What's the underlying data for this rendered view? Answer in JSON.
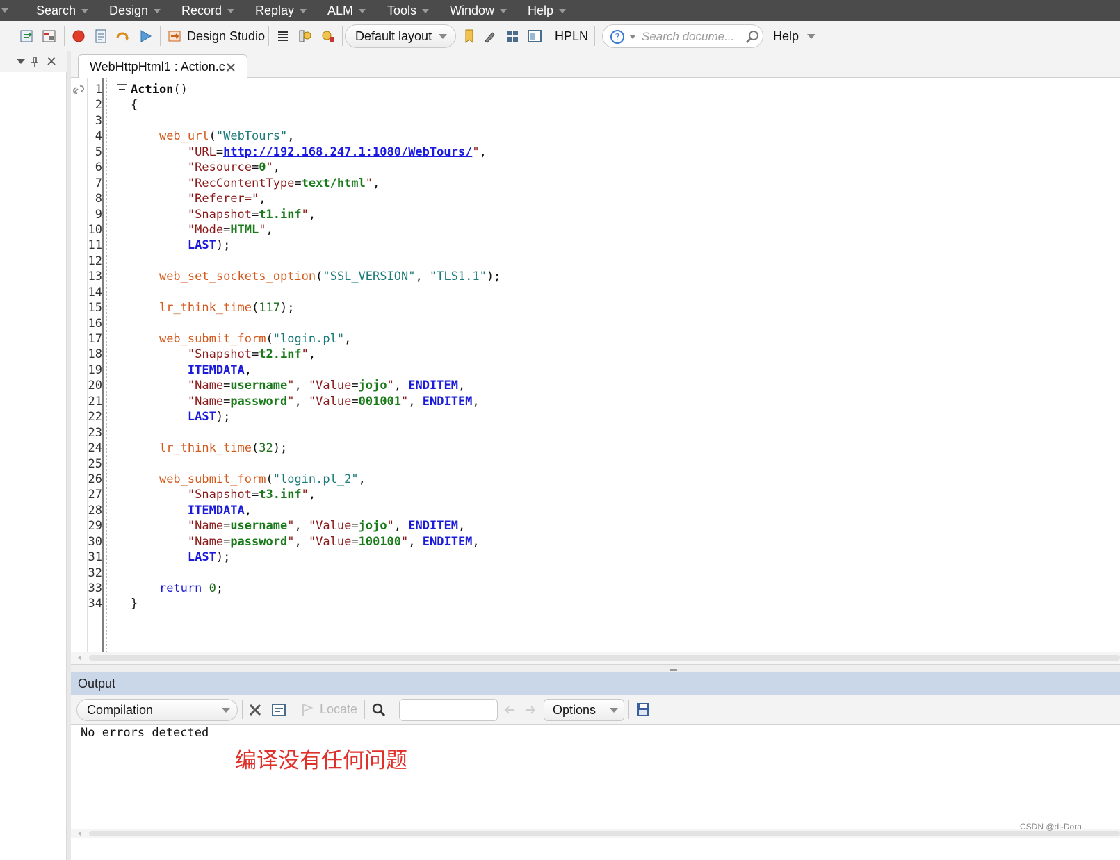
{
  "menu": {
    "items": [
      {
        "label": "Search"
      },
      {
        "label": "Design"
      },
      {
        "label": "Record"
      },
      {
        "label": "Replay"
      },
      {
        "label": "ALM"
      },
      {
        "label": "Tools"
      },
      {
        "label": "Window"
      },
      {
        "label": "Help"
      }
    ]
  },
  "toolbar": {
    "design_studio_label": "Design Studio",
    "layout_label": "Default layout",
    "hpln_label": "HPLN",
    "search_placeholder": "Search docume...",
    "help_label": "Help"
  },
  "editor": {
    "tab_title": "WebHttpHtml1 : Action.c",
    "line_numbers": [
      "1",
      "2",
      "3",
      "4",
      "5",
      "6",
      "7",
      "8",
      "9",
      "10",
      "11",
      "12",
      "13",
      "14",
      "15",
      "16",
      "17",
      "18",
      "19",
      "20",
      "21",
      "22",
      "23",
      "24",
      "25",
      "26",
      "27",
      "28",
      "29",
      "30",
      "31",
      "32",
      "33",
      "34"
    ],
    "code_lines": [
      [
        {
          "t": "Action",
          "c": "bold"
        },
        {
          "t": "()",
          "c": ""
        }
      ],
      [
        {
          "t": "{",
          "c": ""
        }
      ],
      [],
      [
        {
          "t": "    ",
          "c": ""
        },
        {
          "t": "web_url",
          "c": "fn"
        },
        {
          "t": "(",
          "c": ""
        },
        {
          "t": "\"WebTours\"",
          "c": "str"
        },
        {
          "t": ",",
          "c": ""
        }
      ],
      [
        {
          "t": "        \"",
          "c": "sv"
        },
        {
          "t": "URL",
          "c": "sv"
        },
        {
          "t": "=",
          "c": ""
        },
        {
          "t": "http://192.168.247.1:1080/WebTours/",
          "c": "url"
        },
        {
          "t": "\"",
          "c": "sv"
        },
        {
          "t": ",",
          "c": ""
        }
      ],
      [
        {
          "t": "        \"Resource",
          "c": "sv"
        },
        {
          "t": "=",
          "c": ""
        },
        {
          "t": "0",
          "c": "val"
        },
        {
          "t": "\"",
          "c": "sv"
        },
        {
          "t": ",",
          "c": ""
        }
      ],
      [
        {
          "t": "        \"RecContentType",
          "c": "sv"
        },
        {
          "t": "=",
          "c": ""
        },
        {
          "t": "text/html",
          "c": "val"
        },
        {
          "t": "\"",
          "c": "sv"
        },
        {
          "t": ",",
          "c": ""
        }
      ],
      [
        {
          "t": "        \"Referer=\"",
          "c": "sv"
        },
        {
          "t": ",",
          "c": ""
        }
      ],
      [
        {
          "t": "        \"Snapshot",
          "c": "sv"
        },
        {
          "t": "=",
          "c": ""
        },
        {
          "t": "t1.inf",
          "c": "val"
        },
        {
          "t": "\"",
          "c": "sv"
        },
        {
          "t": ",",
          "c": ""
        }
      ],
      [
        {
          "t": "        \"Mode",
          "c": "sv"
        },
        {
          "t": "=",
          "c": ""
        },
        {
          "t": "HTML",
          "c": "val"
        },
        {
          "t": "\"",
          "c": "sv"
        },
        {
          "t": ",",
          "c": ""
        }
      ],
      [
        {
          "t": "        ",
          "c": ""
        },
        {
          "t": "LAST",
          "c": "kwb"
        },
        {
          "t": ");",
          "c": ""
        }
      ],
      [],
      [
        {
          "t": "    ",
          "c": ""
        },
        {
          "t": "web_set_sockets_option",
          "c": "fn"
        },
        {
          "t": "(",
          "c": ""
        },
        {
          "t": "\"SSL_VERSION\"",
          "c": "str"
        },
        {
          "t": ", ",
          "c": ""
        },
        {
          "t": "\"TLS1.1\"",
          "c": "str"
        },
        {
          "t": ");",
          "c": ""
        }
      ],
      [],
      [
        {
          "t": "    ",
          "c": ""
        },
        {
          "t": "lr_think_time",
          "c": "fn"
        },
        {
          "t": "(",
          "c": ""
        },
        {
          "t": "117",
          "c": "num"
        },
        {
          "t": ");",
          "c": ""
        }
      ],
      [],
      [
        {
          "t": "    ",
          "c": ""
        },
        {
          "t": "web_submit_form",
          "c": "fn"
        },
        {
          "t": "(",
          "c": ""
        },
        {
          "t": "\"login.pl\"",
          "c": "str"
        },
        {
          "t": ",",
          "c": ""
        }
      ],
      [
        {
          "t": "        \"Snapshot",
          "c": "sv"
        },
        {
          "t": "=",
          "c": ""
        },
        {
          "t": "t2.inf",
          "c": "val"
        },
        {
          "t": "\"",
          "c": "sv"
        },
        {
          "t": ",",
          "c": ""
        }
      ],
      [
        {
          "t": "        ",
          "c": ""
        },
        {
          "t": "ITEMDATA",
          "c": "kwb"
        },
        {
          "t": ",",
          "c": ""
        }
      ],
      [
        {
          "t": "        \"Name",
          "c": "sv"
        },
        {
          "t": "=",
          "c": ""
        },
        {
          "t": "username",
          "c": "val"
        },
        {
          "t": "\"",
          "c": "sv"
        },
        {
          "t": ", ",
          "c": ""
        },
        {
          "t": "\"Value",
          "c": "sv"
        },
        {
          "t": "=",
          "c": ""
        },
        {
          "t": "jojo",
          "c": "val"
        },
        {
          "t": "\"",
          "c": "sv"
        },
        {
          "t": ", ",
          "c": ""
        },
        {
          "t": "ENDITEM",
          "c": "kwb"
        },
        {
          "t": ",",
          "c": ""
        }
      ],
      [
        {
          "t": "        \"Name",
          "c": "sv"
        },
        {
          "t": "=",
          "c": ""
        },
        {
          "t": "password",
          "c": "val"
        },
        {
          "t": "\"",
          "c": "sv"
        },
        {
          "t": ", ",
          "c": ""
        },
        {
          "t": "\"Value",
          "c": "sv"
        },
        {
          "t": "=",
          "c": ""
        },
        {
          "t": "001001",
          "c": "val"
        },
        {
          "t": "\"",
          "c": "sv"
        },
        {
          "t": ", ",
          "c": ""
        },
        {
          "t": "ENDITEM",
          "c": "kwb"
        },
        {
          "t": ",",
          "c": ""
        }
      ],
      [
        {
          "t": "        ",
          "c": ""
        },
        {
          "t": "LAST",
          "c": "kwb"
        },
        {
          "t": ");",
          "c": ""
        }
      ],
      [],
      [
        {
          "t": "    ",
          "c": ""
        },
        {
          "t": "lr_think_time",
          "c": "fn"
        },
        {
          "t": "(",
          "c": ""
        },
        {
          "t": "32",
          "c": "num"
        },
        {
          "t": ");",
          "c": ""
        }
      ],
      [],
      [
        {
          "t": "    ",
          "c": ""
        },
        {
          "t": "web_submit_form",
          "c": "fn"
        },
        {
          "t": "(",
          "c": ""
        },
        {
          "t": "\"login.pl_2\"",
          "c": "str"
        },
        {
          "t": ",",
          "c": ""
        }
      ],
      [
        {
          "t": "        \"Snapshot",
          "c": "sv"
        },
        {
          "t": "=",
          "c": ""
        },
        {
          "t": "t3.inf",
          "c": "val"
        },
        {
          "t": "\"",
          "c": "sv"
        },
        {
          "t": ",",
          "c": ""
        }
      ],
      [
        {
          "t": "        ",
          "c": ""
        },
        {
          "t": "ITEMDATA",
          "c": "kwb"
        },
        {
          "t": ",",
          "c": ""
        }
      ],
      [
        {
          "t": "        \"Name",
          "c": "sv"
        },
        {
          "t": "=",
          "c": ""
        },
        {
          "t": "username",
          "c": "val"
        },
        {
          "t": "\"",
          "c": "sv"
        },
        {
          "t": ", ",
          "c": ""
        },
        {
          "t": "\"Value",
          "c": "sv"
        },
        {
          "t": "=",
          "c": ""
        },
        {
          "t": "jojo",
          "c": "val"
        },
        {
          "t": "\"",
          "c": "sv"
        },
        {
          "t": ", ",
          "c": ""
        },
        {
          "t": "ENDITEM",
          "c": "kwb"
        },
        {
          "t": ",",
          "c": ""
        }
      ],
      [
        {
          "t": "        \"Name",
          "c": "sv"
        },
        {
          "t": "=",
          "c": ""
        },
        {
          "t": "password",
          "c": "val"
        },
        {
          "t": "\"",
          "c": "sv"
        },
        {
          "t": ", ",
          "c": ""
        },
        {
          "t": "\"Value",
          "c": "sv"
        },
        {
          "t": "=",
          "c": ""
        },
        {
          "t": "100100",
          "c": "val"
        },
        {
          "t": "\"",
          "c": "sv"
        },
        {
          "t": ", ",
          "c": ""
        },
        {
          "t": "ENDITEM",
          "c": "kwb"
        },
        {
          "t": ",",
          "c": ""
        }
      ],
      [
        {
          "t": "        ",
          "c": ""
        },
        {
          "t": "LAST",
          "c": "kwb"
        },
        {
          "t": ");",
          "c": ""
        }
      ],
      [],
      [
        {
          "t": "    ",
          "c": ""
        },
        {
          "t": "return",
          "c": "kw"
        },
        {
          "t": " ",
          "c": ""
        },
        {
          "t": "0",
          "c": "num"
        },
        {
          "t": ";",
          "c": ""
        }
      ],
      [
        {
          "t": "}",
          "c": ""
        }
      ]
    ]
  },
  "output": {
    "title": "Output",
    "filter_label": "Compilation",
    "locate_label": "Locate",
    "options_label": "Options",
    "message": "No errors detected",
    "annotation": "编译没有任何问题"
  },
  "watermark": "CSDN @di-Dora",
  "colors": {
    "menubar": "#4b4b4b",
    "function": "#d4581a",
    "string": "#1a7a7a",
    "keyword": "#1a1ad8",
    "value": "#1a7a1a",
    "annotation": "#e0302a"
  }
}
